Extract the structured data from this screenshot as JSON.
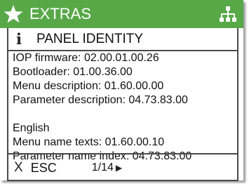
{
  "titlebar": {
    "title": "EXTRAS",
    "star_icon": "star-icon",
    "network_icon": "network-tree-icon",
    "accent": "#58a848"
  },
  "panel": {
    "info_icon": "i",
    "title": "PANEL IDENTITY"
  },
  "content": {
    "lines": [
      "IOP firmware: 02.00.01.00.26",
      "Bootloader: 01.00.36.00",
      "Menu description: 01.60.00.00",
      "Parameter description: 04.73.83.00",
      "",
      "English",
      "Menu name texts: 01.60.00.10",
      "Parameter name index: 04.73.83.00"
    ]
  },
  "footer": {
    "close_glyph": "X",
    "esc_label": "ESC",
    "page": "1/14",
    "next_glyph": "▶"
  }
}
